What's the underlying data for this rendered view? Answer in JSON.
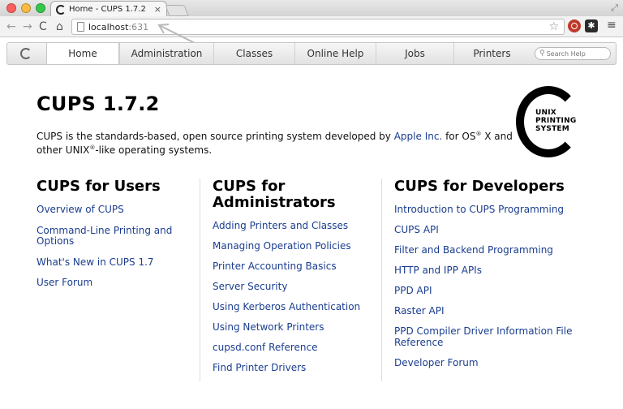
{
  "browser": {
    "tab_title": "Home - CUPS 1.7.2",
    "tab_close": "×",
    "url_host": "localhost",
    "url_port": ":631",
    "nav": {
      "back": "←",
      "forward": "→",
      "reload": "C",
      "home": "⌂"
    },
    "star": "☆",
    "menu": "≡",
    "ext2_label": "✱",
    "resize": "⤢"
  },
  "cups_nav": {
    "tabs": [
      {
        "label": "Home",
        "active": true
      },
      {
        "label": "Administration"
      },
      {
        "label": "Classes"
      },
      {
        "label": "Online Help"
      },
      {
        "label": "Jobs"
      },
      {
        "label": "Printers"
      }
    ],
    "search_placeholder": "Search Help",
    "search_icon": "🔍"
  },
  "main": {
    "title": "CUPS 1.7.2",
    "intro_before_link": "CUPS is the standards-based, open source printing system developed by ",
    "intro_link": "Apple Inc.",
    "intro_mid1": " for OS",
    "intro_reg1": "®",
    "intro_mid2": " X and other UNIX",
    "intro_reg2": "®",
    "intro_end": "-like operating systems.",
    "logo_lines": [
      "UNIX",
      "PRINTING",
      "SYSTEM"
    ]
  },
  "columns": [
    {
      "heading": "CUPS for Users",
      "links": [
        "Overview of CUPS",
        "Command-Line Printing and Options",
        "What's New in CUPS 1.7",
        "User Forum"
      ]
    },
    {
      "heading": "CUPS for Administrators",
      "links": [
        "Adding Printers and Classes",
        "Managing Operation Policies",
        "Printer Accounting Basics",
        "Server Security",
        "Using Kerberos Authentication",
        "Using Network Printers",
        "cupsd.conf Reference",
        "Find Printer Drivers"
      ]
    },
    {
      "heading": "CUPS for Developers",
      "links": [
        "Introduction to CUPS Programming",
        "CUPS API",
        "Filter and Backend Programming",
        "HTTP and IPP APIs",
        "PPD API",
        "Raster API",
        "PPD Compiler Driver Information File Reference",
        "Developer Forum"
      ]
    }
  ]
}
